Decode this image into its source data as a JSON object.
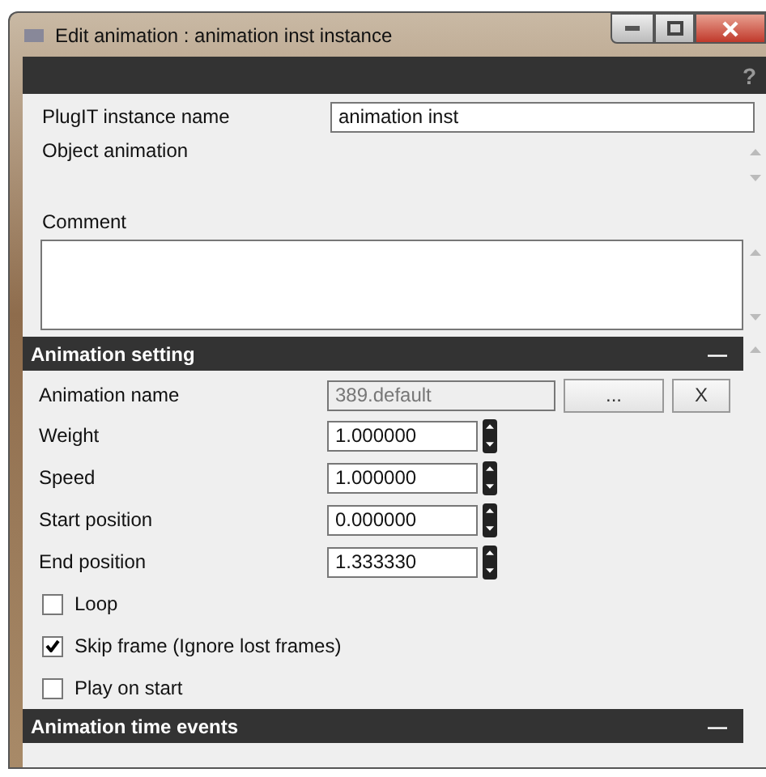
{
  "window": {
    "title": "Edit animation : animation inst instance"
  },
  "help": {
    "symbol": "?"
  },
  "instance_name": {
    "label": "PlugIT instance name",
    "value": "animation inst"
  },
  "object_animation": {
    "label": "Object animation"
  },
  "comment": {
    "label": "Comment"
  },
  "sections": [
    {
      "title": "Animation setting",
      "collapse": "—",
      "animation_name": {
        "label": "Animation name",
        "value": "389.default",
        "disabled": true,
        "browse": "...",
        "clear": "X"
      },
      "spinners": [
        {
          "label": "Weight",
          "value": "1.000000"
        },
        {
          "label": "Speed",
          "value": "1.000000"
        },
        {
          "label": "Start position",
          "value": "0.000000"
        },
        {
          "label": "End position",
          "value": "1.333330"
        }
      ],
      "checkboxes": [
        {
          "label": "Loop",
          "checked": false
        },
        {
          "label": "Skip frame (Ignore lost frames)",
          "checked": true
        },
        {
          "label": "Play on start",
          "checked": false
        }
      ]
    },
    {
      "title": "Animation time events",
      "collapse": "—"
    }
  ]
}
